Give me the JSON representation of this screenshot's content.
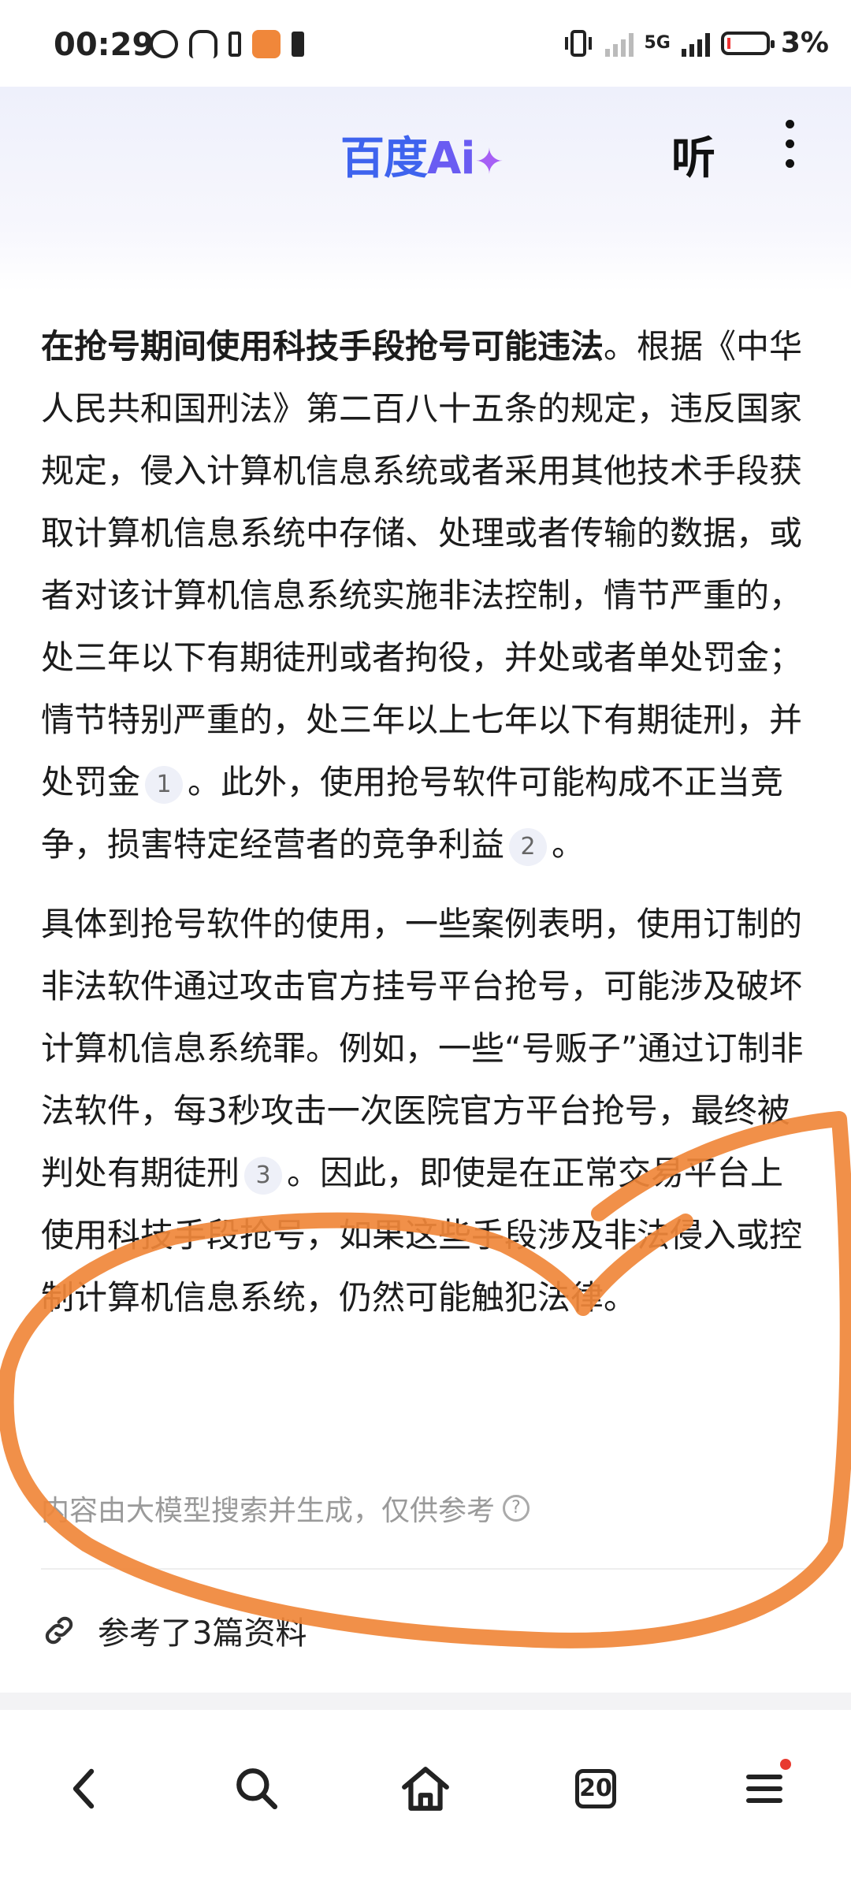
{
  "status_bar": {
    "time": "00:29",
    "network": "5G",
    "battery": "3%",
    "icons": [
      "alarm-icon",
      "headphones-icon",
      "battery-small-icon",
      "app-notification-icon",
      "sd-card-icon",
      "vibrate-icon",
      "signal-icon",
      "battery-icon"
    ]
  },
  "header": {
    "logo_main": "百度",
    "logo_ai": "Ai",
    "logo_star": "✦",
    "listen_label": "听",
    "more_icon": "more-vertical-icon"
  },
  "answer": {
    "p1_bold": "在抢号期间使用科技手段抢号可能违法",
    "p1_a": "。根据《中华人民共和国刑法》第二百八十五条的规定，违反国家规定，侵入计算机信息系统或者采用其他技术手段获取计算机信息系统中存储、处理或者传输的数据，或者对该计算机信息系统实施非法控制，情节严重的，处三年以下有期徒刑或者拘役，并处或者单处罚金；情节特别严重的，处三年以上七年以下有期徒刑，并处罚金",
    "cite1": "1",
    "p1_b": "。此外，使用抢号软件可能构成不正当竞争，损害特定经营者的竞争利益",
    "cite2": "2",
    "p1_c": "。",
    "p2_a": "具体到抢号软件的使用，一些案例表明，使用订制的非法软件通过攻击官方挂号平台抢号，可能涉及破坏计算机信息系统罪。例如，一些“号贩子”通过订制非法软件，每3秒攻击一次医院官方平台抢号，最终被判处有期徒刑",
    "cite3": "3",
    "p2_b": "。因此，即使是在正常交易平台上使用科技手段抢号，如果这些手段涉及非法侵入或控制计算机信息系统，仍然可能触犯法律。",
    "disclaimer": "内容由大模型搜索并生成，仅供参考",
    "references": "参考了3篇资料"
  },
  "navbar": {
    "tab_count": "20",
    "items": [
      "back-icon",
      "search-icon",
      "home-icon",
      "tabs-icon",
      "menu-icon"
    ]
  },
  "colors": {
    "accent": "#3e63ee",
    "annotation": "#f0873a",
    "notification_dot": "#e83a2f"
  }
}
